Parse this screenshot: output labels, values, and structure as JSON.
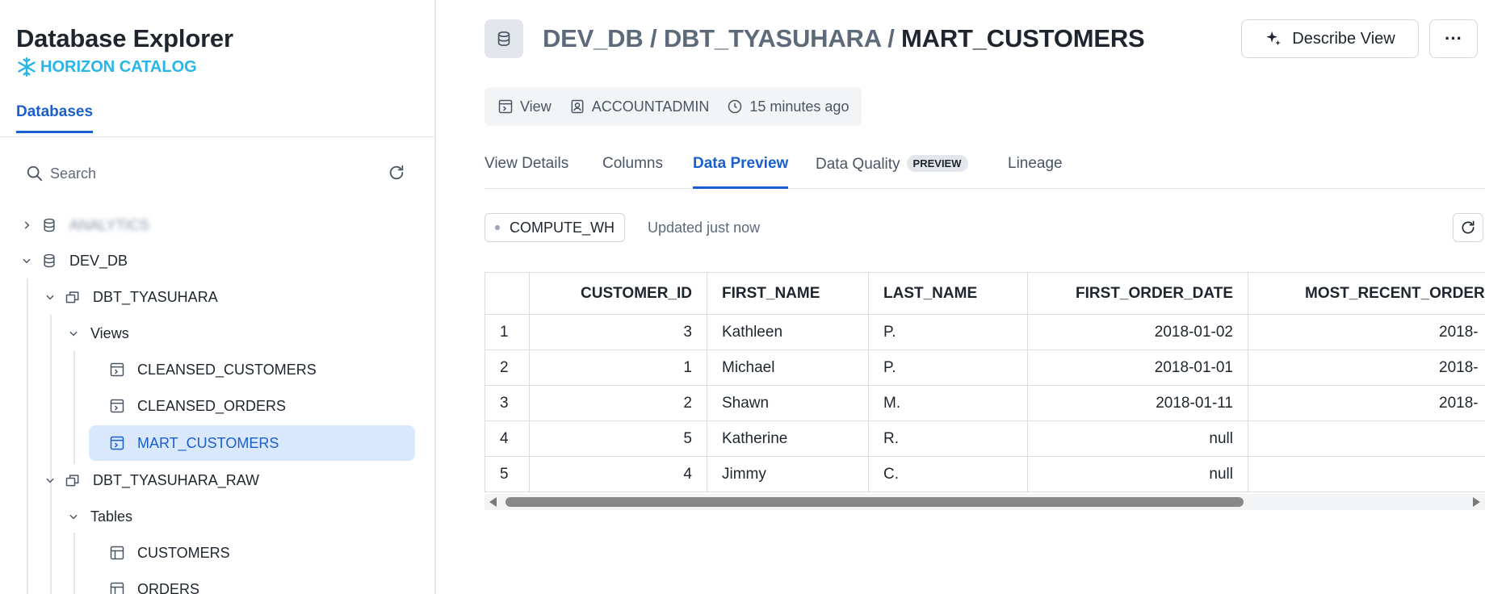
{
  "sidebar": {
    "title": "Database Explorer",
    "brand": "HORIZON CATALOG",
    "tab": "Databases",
    "search_placeholder": "Search",
    "tree": [
      {
        "label": "ANALYTICS"
      },
      {
        "label": "DEV_DB"
      },
      {
        "label": "DBT_TYASUHARA"
      },
      {
        "label": "Views"
      },
      {
        "label": "CLEANSED_CUSTOMERS"
      },
      {
        "label": "CLEANSED_ORDERS"
      },
      {
        "label": "MART_CUSTOMERS"
      },
      {
        "label": "DBT_TYASUHARA_RAW"
      },
      {
        "label": "Tables"
      },
      {
        "label": "CUSTOMERS"
      },
      {
        "label": "ORDERS"
      }
    ]
  },
  "header": {
    "crumb_db": "DEV_DB",
    "crumb_sep": " / ",
    "crumb_schema": "DBT_TYASUHARA",
    "crumb_object": "MART_CUSTOMERS",
    "describe_label": "Describe View",
    "more_label": "···"
  },
  "meta": {
    "type": "View",
    "owner": "ACCOUNTADMIN",
    "modified": "15 minutes ago"
  },
  "tabs": [
    {
      "label": "View Details"
    },
    {
      "label": "Columns"
    },
    {
      "label": "Data Preview"
    },
    {
      "label": "Data Quality",
      "badge": "PREVIEW"
    },
    {
      "label": "Lineage"
    }
  ],
  "preview": {
    "warehouse": "COMPUTE_WH",
    "updated": "Updated just now",
    "columns": [
      "CUSTOMER_ID",
      "FIRST_NAME",
      "LAST_NAME",
      "FIRST_ORDER_DATE",
      "MOST_RECENT_ORDER"
    ],
    "rows": [
      {
        "idx": "1",
        "id": "3",
        "first": "Kathleen",
        "last": "P.",
        "first_order": "2018-01-02",
        "recent": "2018-"
      },
      {
        "idx": "2",
        "id": "1",
        "first": "Michael",
        "last": "P.",
        "first_order": "2018-01-01",
        "recent": "2018-"
      },
      {
        "idx": "3",
        "id": "2",
        "first": "Shawn",
        "last": "M.",
        "first_order": "2018-01-11",
        "recent": "2018-"
      },
      {
        "idx": "4",
        "id": "5",
        "first": "Katherine",
        "last": "R.",
        "first_order": "null",
        "recent": ""
      },
      {
        "idx": "5",
        "id": "4",
        "first": "Jimmy",
        "last": "C.",
        "first_order": "null",
        "recent": ""
      }
    ]
  },
  "colors": {
    "accent": "#1a5fd0",
    "brand": "#29b5e8",
    "selected_bg": "#d9e8fc"
  }
}
